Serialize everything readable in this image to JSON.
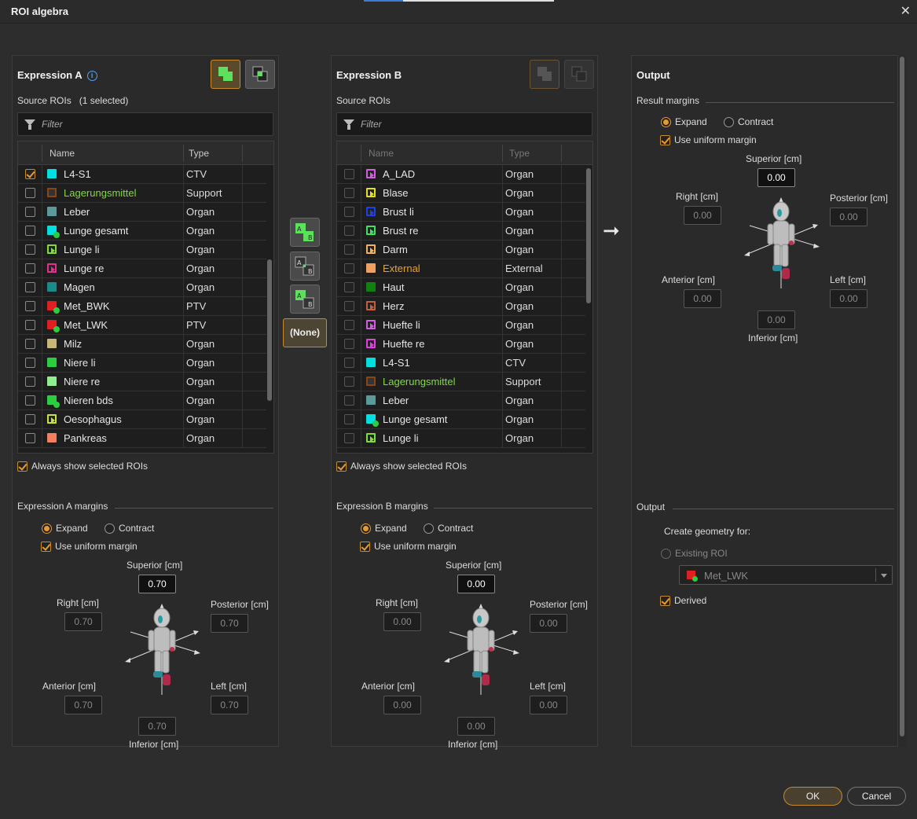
{
  "window": {
    "title": "ROI algebra",
    "close_icon": "close-icon"
  },
  "expression_a": {
    "title": "Expression A",
    "source_label": "Source ROIs",
    "selected_count": "(1 selected)",
    "filter_placeholder": "Filter",
    "col_name": "Name",
    "col_type": "Type",
    "rows": [
      {
        "name": "L4-S1",
        "type": "CTV",
        "color": "#00e0e0",
        "checked": true,
        "style": "solid"
      },
      {
        "name": "Lagerungsmittel",
        "type": "Support",
        "color": "#8b4513",
        "checked": false,
        "style": "hollow",
        "name_color": "#7fdc3a"
      },
      {
        "name": "Leber",
        "type": "Organ",
        "color": "#5a9a9a",
        "checked": false,
        "style": "solid"
      },
      {
        "name": "Lunge gesamt",
        "type": "Organ",
        "color": "#00e0e0",
        "checked": false,
        "style": "dot"
      },
      {
        "name": "Lunge li",
        "type": "Organ",
        "color": "#7fdc3a",
        "checked": false,
        "style": "tri"
      },
      {
        "name": "Lunge re",
        "type": "Organ",
        "color": "#e0308a",
        "checked": false,
        "style": "tri"
      },
      {
        "name": "Magen",
        "type": "Organ",
        "color": "#1a8a8a",
        "checked": false,
        "style": "solid"
      },
      {
        "name": "Met_BWK",
        "type": "PTV",
        "color": "#e02020",
        "checked": false,
        "style": "dot"
      },
      {
        "name": "Met_LWK",
        "type": "PTV",
        "color": "#e02020",
        "checked": false,
        "style": "dot"
      },
      {
        "name": "Milz",
        "type": "Organ",
        "color": "#c8b878",
        "checked": false,
        "style": "solid"
      },
      {
        "name": "Niere li",
        "type": "Organ",
        "color": "#2ecc40",
        "checked": false,
        "style": "solid"
      },
      {
        "name": "Niere re",
        "type": "Organ",
        "color": "#90ee90",
        "checked": false,
        "style": "solid"
      },
      {
        "name": "Nieren bds",
        "type": "Organ",
        "color": "#2ecc40",
        "checked": false,
        "style": "dot"
      },
      {
        "name": "Oesophagus",
        "type": "Organ",
        "color": "#c8e040",
        "checked": false,
        "style": "tri"
      },
      {
        "name": "Pankreas",
        "type": "Organ",
        "color": "#f08060",
        "checked": false,
        "style": "solid"
      }
    ],
    "always_show": "Always show selected ROIs",
    "margins_title": "Expression A margins",
    "expand": "Expand",
    "contract": "Contract",
    "uniform": "Use uniform margin",
    "superior_label": "Superior [cm]",
    "superior": "0.70",
    "right_label": "Right [cm]",
    "right": "0.70",
    "posterior_label": "Posterior [cm]",
    "posterior": "0.70",
    "anterior_label": "Anterior [cm]",
    "anterior": "0.70",
    "left_label": "Left [cm]",
    "left": "0.70",
    "inferior": "0.70",
    "inferior_label": "Inferior [cm]"
  },
  "expression_b": {
    "title": "Expression B",
    "source_label": "Source ROIs",
    "filter_placeholder": "Filter",
    "col_name": "Name",
    "col_type": "Type",
    "rows": [
      {
        "name": "A_LAD",
        "type": "Organ",
        "color": "#d060e0",
        "checked": false,
        "style": "tri"
      },
      {
        "name": "Blase",
        "type": "Organ",
        "color": "#e0e020",
        "checked": false,
        "style": "tri"
      },
      {
        "name": "Brust li",
        "type": "Organ",
        "color": "#2040e0",
        "checked": false,
        "style": "tri"
      },
      {
        "name": "Brust re",
        "type": "Organ",
        "color": "#40e060",
        "checked": false,
        "style": "tri"
      },
      {
        "name": "Darm",
        "type": "Organ",
        "color": "#f0b060",
        "checked": false,
        "style": "tri"
      },
      {
        "name": "External",
        "type": "External",
        "color": "#f0a060",
        "checked": false,
        "style": "solid",
        "name_color": "#f0a020"
      },
      {
        "name": "Haut",
        "type": "Organ",
        "color": "#108010",
        "checked": false,
        "style": "solid"
      },
      {
        "name": "Herz",
        "type": "Organ",
        "color": "#c06040",
        "checked": false,
        "style": "tri"
      },
      {
        "name": "Huefte li",
        "type": "Organ",
        "color": "#d060e0",
        "checked": false,
        "style": "tri"
      },
      {
        "name": "Huefte re",
        "type": "Organ",
        "color": "#e040e0",
        "checked": false,
        "style": "tri"
      },
      {
        "name": "L4-S1",
        "type": "CTV",
        "color": "#00e0e0",
        "checked": false,
        "style": "solid"
      },
      {
        "name": "Lagerungsmittel",
        "type": "Support",
        "color": "#8b4513",
        "checked": false,
        "style": "hollow",
        "name_color": "#7fdc3a"
      },
      {
        "name": "Leber",
        "type": "Organ",
        "color": "#5a9a9a",
        "checked": false,
        "style": "solid"
      },
      {
        "name": "Lunge gesamt",
        "type": "Organ",
        "color": "#00e0e0",
        "checked": false,
        "style": "dot"
      },
      {
        "name": "Lunge li",
        "type": "Organ",
        "color": "#7fdc3a",
        "checked": false,
        "style": "tri"
      }
    ],
    "always_show": "Always show selected ROIs",
    "margins_title": "Expression B margins",
    "expand": "Expand",
    "contract": "Contract",
    "uniform": "Use uniform margin",
    "superior_label": "Superior [cm]",
    "superior": "0.00",
    "right_label": "Right [cm]",
    "right": "0.00",
    "posterior_label": "Posterior [cm]",
    "posterior": "0.00",
    "anterior_label": "Anterior [cm]",
    "anterior": "0.00",
    "left_label": "Left [cm]",
    "left": "0.00",
    "inferior": "0.00",
    "inferior_label": "Inferior [cm]"
  },
  "operations": {
    "none_label": "(None)"
  },
  "output": {
    "title": "Output",
    "result_margins": "Result margins",
    "expand": "Expand",
    "contract": "Contract",
    "uniform": "Use uniform margin",
    "superior_label": "Superior [cm]",
    "superior": "0.00",
    "right_label": "Right [cm]",
    "right": "0.00",
    "posterior_label": "Posterior [cm]",
    "posterior": "0.00",
    "anterior_label": "Anterior [cm]",
    "anterior": "0.00",
    "left_label": "Left [cm]",
    "left": "0.00",
    "inferior": "0.00",
    "inferior_label": "Inferior [cm]",
    "output_section": "Output",
    "create_geometry": "Create geometry for:",
    "existing_roi": "Existing ROI",
    "selected_roi": "Met_LWK",
    "derived": "Derived"
  },
  "footer": {
    "ok": "OK",
    "cancel": "Cancel"
  }
}
